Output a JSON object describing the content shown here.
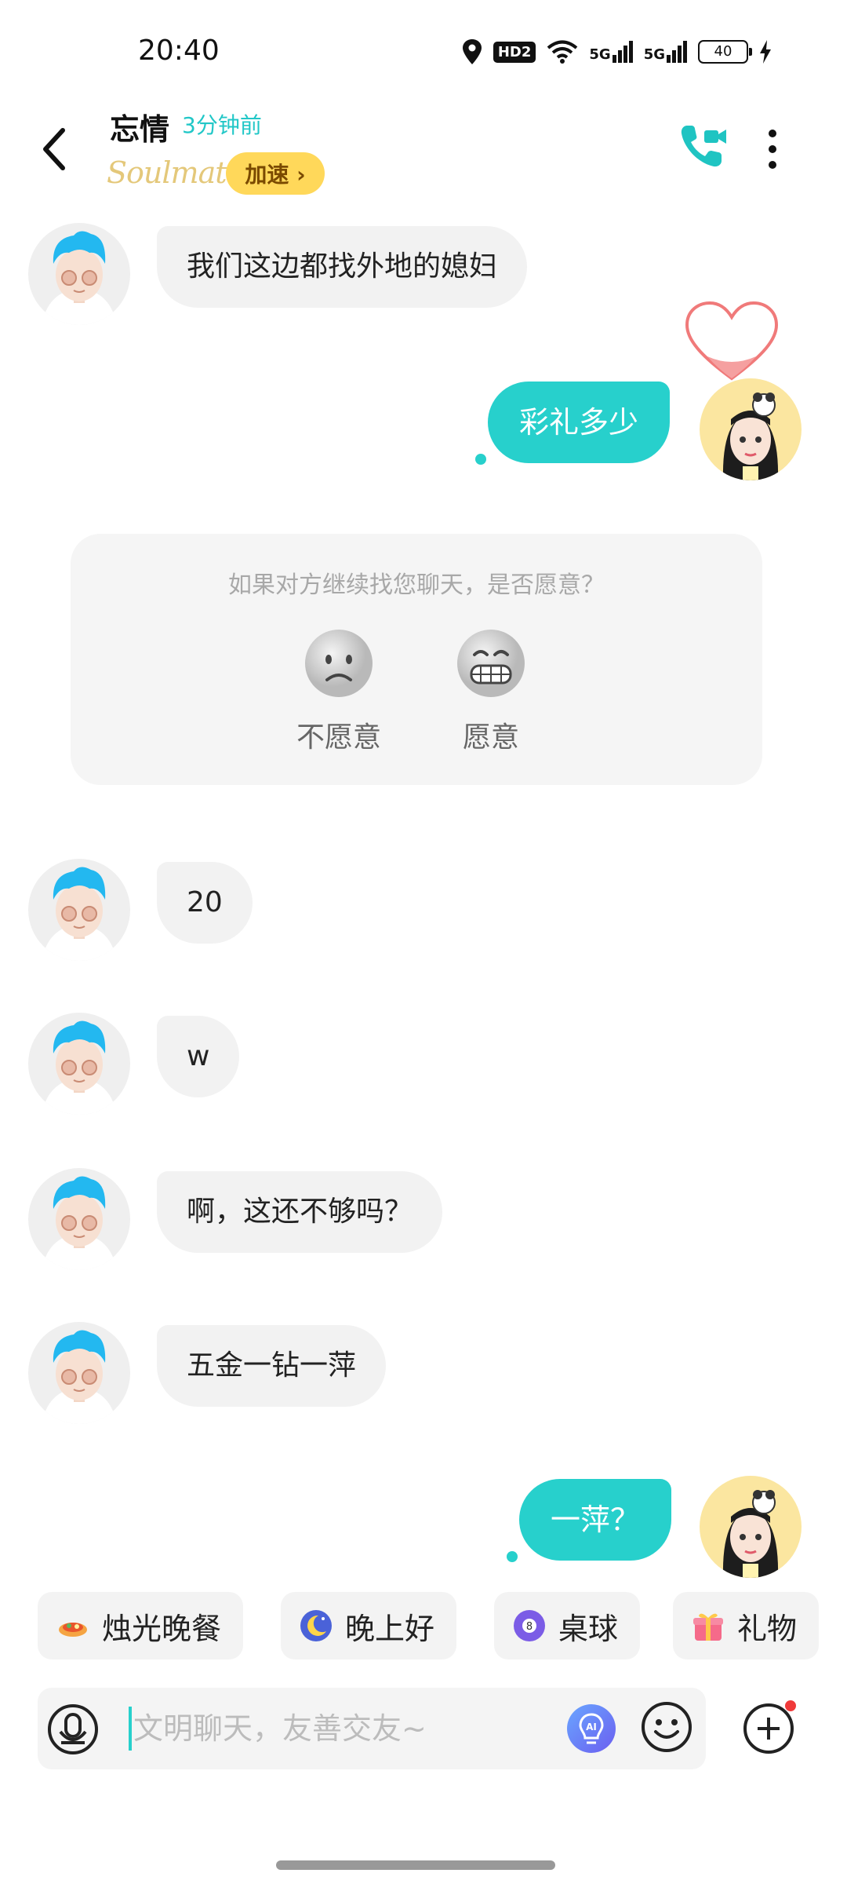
{
  "status_bar": {
    "time": "20:40",
    "hd_label": "HD2",
    "signal1_label": "5G",
    "signal2_label": "5G",
    "battery": "40"
  },
  "header": {
    "name": "忘情",
    "last_seen": "3分钟前",
    "soulmate_badge": "Soulmate",
    "boost_label": "加速 ›"
  },
  "messages": [
    {
      "side": "in",
      "text": "我们这边都找外地的媳妇"
    },
    {
      "side": "out",
      "text": "彩礼多少"
    },
    {
      "side": "in",
      "text": "20"
    },
    {
      "side": "in",
      "text": "w"
    },
    {
      "side": "in",
      "text": "啊，这还不够吗？"
    },
    {
      "side": "in",
      "text": "五金一钻一萍"
    },
    {
      "side": "out",
      "text": "一萍？"
    }
  ],
  "prompt": {
    "question": "如果对方继续找您聊天，是否愿意？",
    "no_label": "不愿意",
    "yes_label": "愿意"
  },
  "quick_chips": [
    {
      "label": "烛光晚餐",
      "icon": "candle-dinner-icon"
    },
    {
      "label": "晚上好",
      "icon": "moon-icon"
    },
    {
      "label": "桌球",
      "icon": "billiards-ball-icon"
    },
    {
      "label": "礼物",
      "icon": "gift-icon"
    }
  ],
  "input": {
    "placeholder": "文明聊天，友善交友~"
  },
  "colors": {
    "accent": "#27d0cc",
    "boost_bg": "#ffd85a",
    "bubble_in": "#f2f2f2"
  }
}
